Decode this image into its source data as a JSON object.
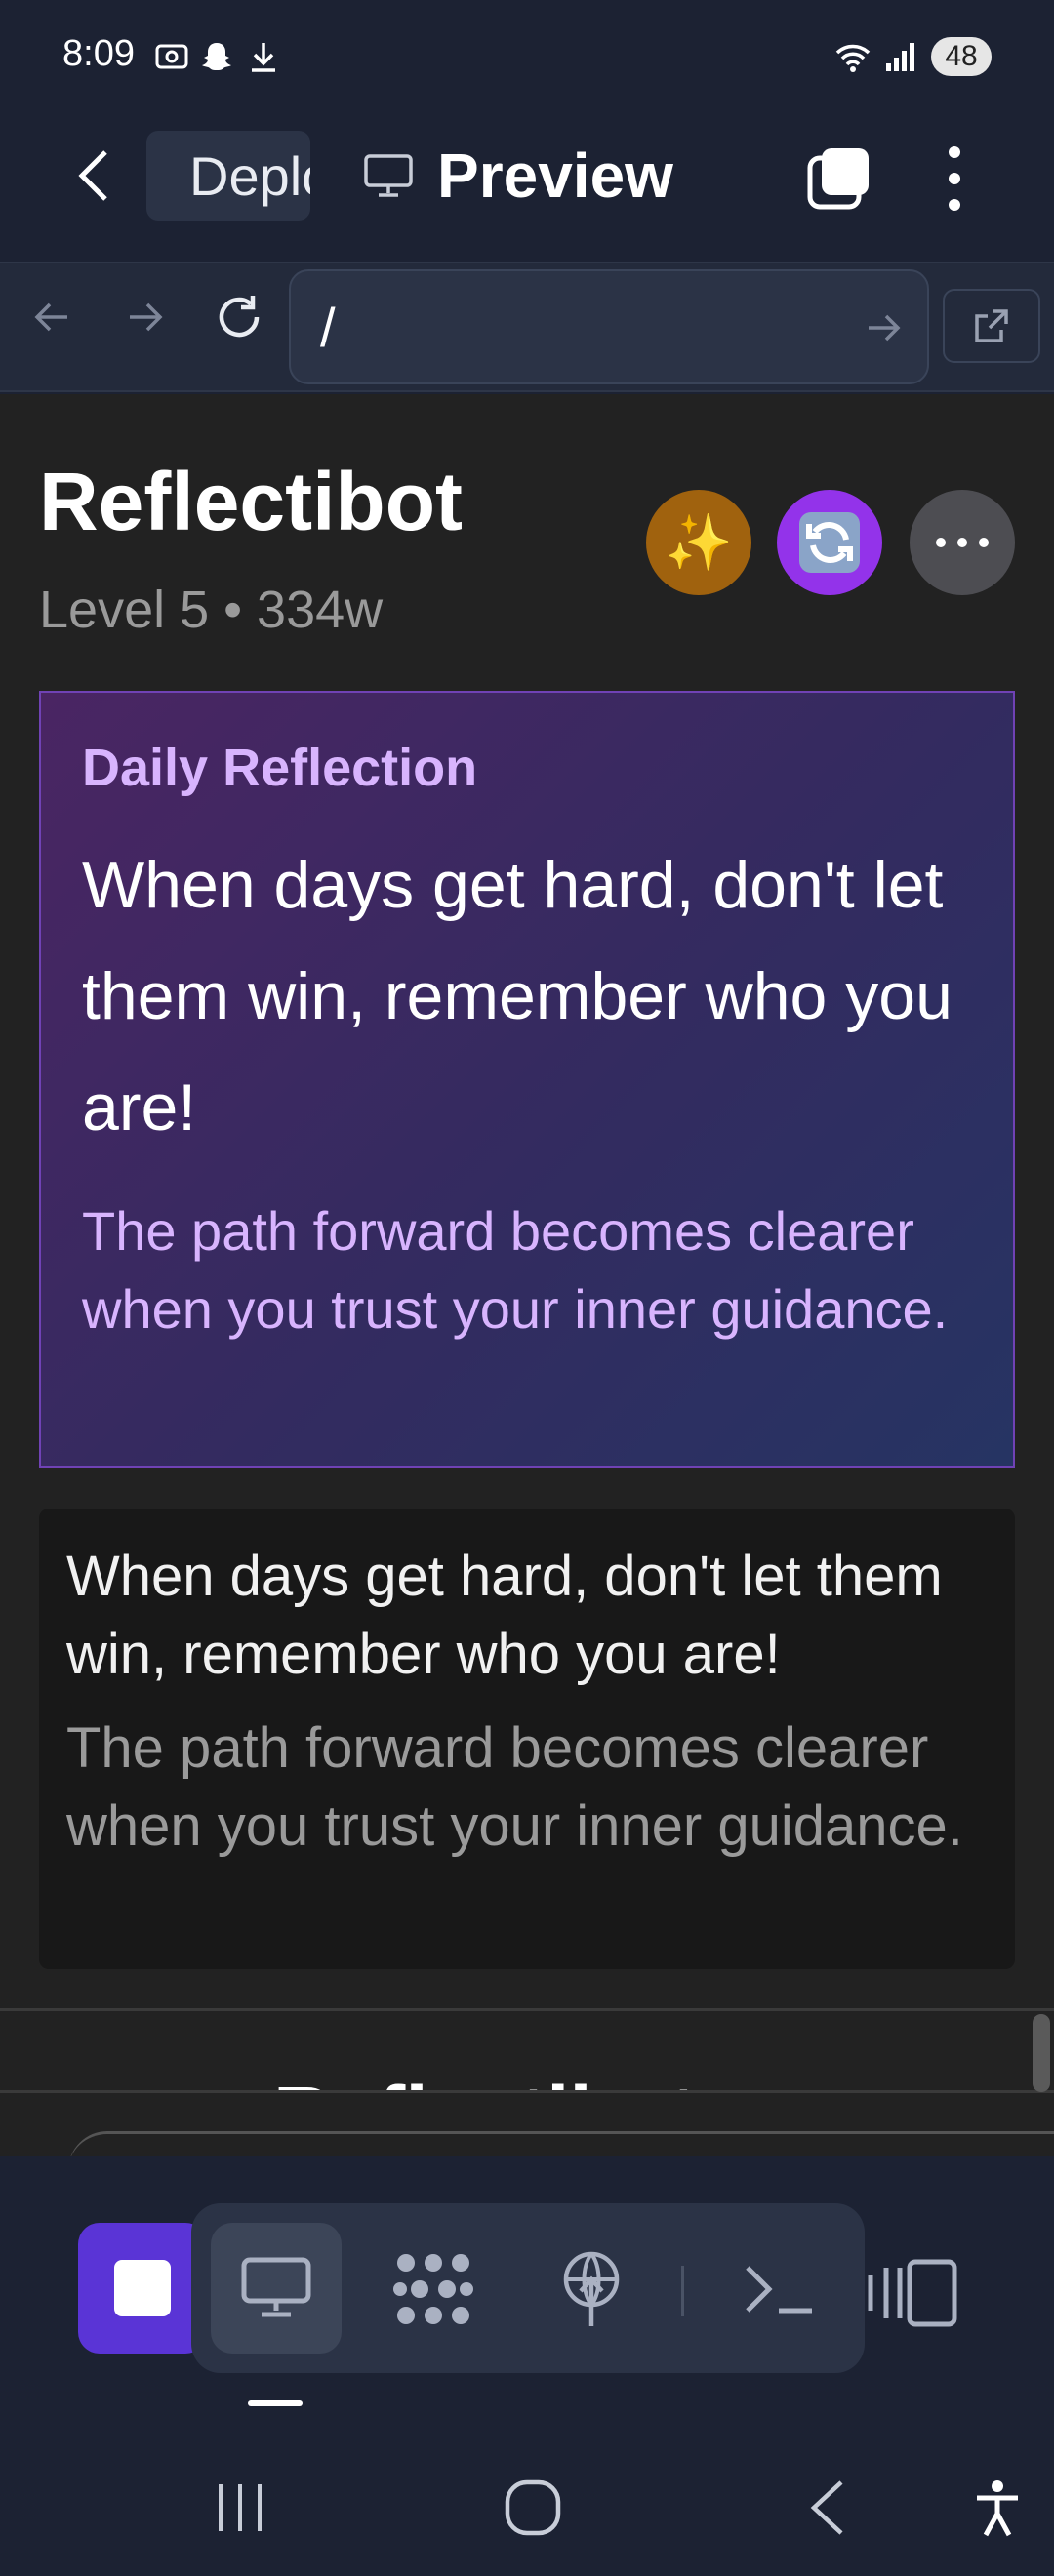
{
  "status_bar": {
    "time": "8:09",
    "battery": "48",
    "icons": [
      "screenshot-icon",
      "snapchat-icon",
      "download-icon",
      "wifi-icon",
      "signal-icon"
    ]
  },
  "header": {
    "deploy_tab_label": "Deploy",
    "preview_tab_label": "Preview",
    "icons": [
      "back-icon",
      "deploy-icon",
      "monitor-icon",
      "tabs-icon",
      "more-vertical-icon"
    ]
  },
  "url_bar": {
    "value": "/",
    "icons": [
      "nav-back-icon",
      "nav-forward-icon",
      "reload-icon",
      "go-arrow-icon",
      "open-external-icon"
    ]
  },
  "page": {
    "title": "Reflectibot",
    "subtitle": "Level 5 • 334w",
    "buttons": {
      "sparkle": "✨",
      "refresh": "🔄",
      "options": "⋯"
    },
    "reflection_card": {
      "heading": "Daily Reflection",
      "quote": "When days get hard, don't let them win, remember who you are!",
      "body": "The path forward becomes clearer when you trust your inner guidance."
    },
    "plain_card": {
      "quote": "When days get hard, don't let them win, remember who you are!",
      "body": "The path forward becomes clearer when you trust your inner guidance."
    },
    "partial_heading": "Reflectibot"
  },
  "colors": {
    "accent": "#5a34d6",
    "card_heading": "#d8b4fe",
    "sparkle_button": "#a0620e",
    "refresh_button": "#9333ea"
  },
  "bottom_toolbar": {
    "icons": [
      "stop-icon",
      "monitor-icon",
      "workflow-icon",
      "deploy-icon",
      "terminal-icon",
      "devices-icon"
    ]
  },
  "system_nav": {
    "icons": [
      "recents-icon",
      "home-icon",
      "back-icon",
      "accessibility-icon"
    ]
  }
}
